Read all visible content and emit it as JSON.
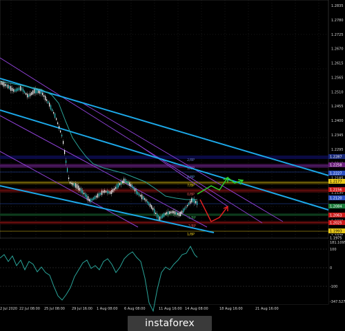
{
  "chart_data": [
    {
      "type": "line",
      "title": "",
      "ylim": [
        1.1975,
        1.2835
      ],
      "y_ticks": [
        "1.2835",
        "1.2780",
        "1.2725",
        "1.2670",
        "1.2615",
        "1.2565",
        "1.2510",
        "1.2455",
        "1.2400",
        "1.2345",
        "1.2295",
        "1.2240",
        "1.2185",
        "1.2130",
        "1.2075",
        "1.2020",
        "1.1975"
      ],
      "x_ticks": [
        "2 Jul 2020",
        "22 Jul 08:00",
        "25 Jul 08:00",
        "29 Jul 16:00",
        "1 Aug 08:00",
        "6 Aug 08:00",
        "11 Aug 16:00",
        "14 Aug 08:00",
        "18 Aug 16:00",
        "21 Aug 16:00"
      ],
      "price_tags": [
        {
          "label": "1.2287",
          "color": "#1a2a7a"
        },
        {
          "label": "1.2258",
          "color": "#6a1f7a"
        },
        {
          "label": "1.2227",
          "color": "#2b4fbf"
        },
        {
          "label": "1.2177",
          "color": "#e8c81a"
        },
        {
          "label": "1.2156",
          "color": "#cc1b1b"
        },
        {
          "label": "1.2120",
          "color": "#2b4fbf"
        },
        {
          "label": "1.2084",
          "color": "#1a7a3a"
        },
        {
          "label": "1.2063",
          "color": "#cc1b1b"
        },
        {
          "label": "1.2025",
          "color": "#cc1b1b"
        },
        {
          "label": "1.1993",
          "color": "#e8c81a"
        },
        {
          "label": "1.1975",
          "color": "#000000"
        }
      ],
      "level_labels": [
        "2/8P",
        "1/8P",
        "8/8P",
        "7/8P",
        "0/8P",
        "-1/8P",
        "-2/8P",
        "1/8P"
      ],
      "colors": {
        "up_candle": "#2ec4c4",
        "down_candle": "#ffffff",
        "trend": "#1ca8e8",
        "channel": "#8b3fd0",
        "ma": "#2aa59a"
      }
    },
    {
      "type": "line",
      "title": "",
      "y_ticks": [
        "181.1095",
        "100",
        "0",
        "-100",
        "-347.527"
      ],
      "colors": {
        "line": "#2aa59a"
      }
    }
  ],
  "footer": {
    "brand": "instaforex",
    "icon": "instaforex-logo-icon"
  }
}
